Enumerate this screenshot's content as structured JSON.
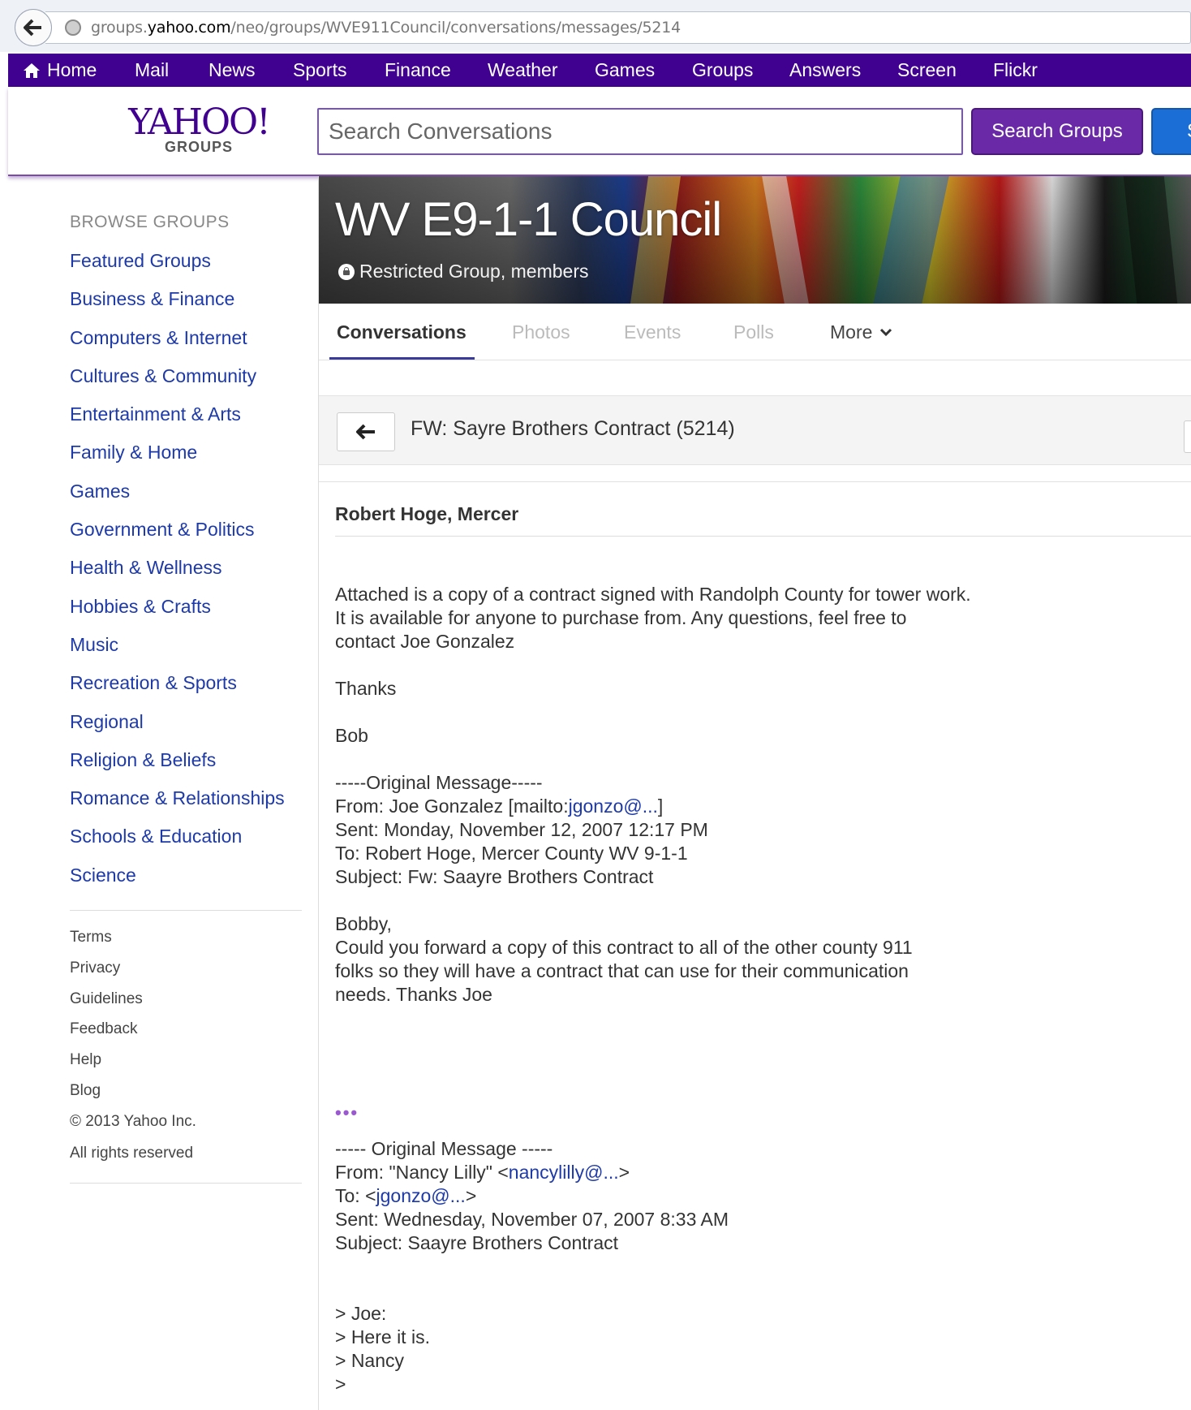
{
  "browser": {
    "url_prefix": "groups.",
    "url_domain": "yahoo.com",
    "url_path": "/neo/groups/WVE911Council/conversations/messages/5214"
  },
  "nav": {
    "items": [
      "Home",
      "Mail",
      "News",
      "Sports",
      "Finance",
      "Weather",
      "Games",
      "Groups",
      "Answers",
      "Screen",
      "Flickr"
    ]
  },
  "header": {
    "logo_main": "YAHOO!",
    "logo_sub": "GROUPS",
    "search_placeholder": "Search Conversations",
    "search_groups_label": "Search Groups",
    "web_button_label": "S"
  },
  "sidebar": {
    "title": "BROWSE GROUPS",
    "categories": [
      "Featured Groups",
      "Business & Finance",
      "Computers & Internet",
      "Cultures & Community",
      "Entertainment & Arts",
      "Family & Home",
      "Games",
      "Government & Politics",
      "Health & Wellness",
      "Hobbies & Crafts",
      "Music",
      "Recreation & Sports",
      "Regional",
      "Religion & Beliefs",
      "Romance & Relationships",
      "Schools & Education",
      "Science"
    ],
    "footer_links": [
      "Terms",
      "Privacy",
      "Guidelines",
      "Feedback",
      "Help",
      "Blog"
    ],
    "copyright": "© 2013 Yahoo Inc.",
    "rights": "All rights reserved"
  },
  "group": {
    "title": "WV E9-1-1 Council",
    "subtitle": "Restricted Group, members"
  },
  "tabs": {
    "conversations": "Conversations",
    "photos": "Photos",
    "events": "Events",
    "polls": "Polls",
    "more": "More"
  },
  "thread": {
    "title": "FW: Sayre Brothers Contract (5214)"
  },
  "message": {
    "author": "Robert Hoge, Mercer",
    "p1_l1": "Attached is a copy of a contract signed with Randolph County for tower work.",
    "p1_l2": "It is available for anyone to purchase from. Any questions, feel free to",
    "p1_l3": "contact Joe Gonzalez",
    "thanks": "Thanks",
    "bob": "Bob",
    "orig1_header": "-----Original Message-----",
    "orig1_from_prefix": "From: Joe Gonzalez [mailto:",
    "orig1_from_link": "jgonzo@...",
    "orig1_from_suffix": "]",
    "orig1_sent": "Sent: Monday, November 12, 2007 12:17 PM",
    "orig1_to": "To: Robert Hoge, Mercer County WV 9-1-1",
    "orig1_subject": "Subject: Fw: Saayre Brothers Contract",
    "bobby": "Bobby,",
    "p2_l1": "Could you forward a copy of this contract to all of the other county 911",
    "p2_l2": "folks so they will have a contract that can use for their communication",
    "p2_l3": "needs. Thanks Joe",
    "dots": "•••",
    "orig2_header": "----- Original Message -----",
    "orig2_from_prefix": "From: \"Nancy Lilly\" <",
    "orig2_from_link": "nancylilly@...",
    "orig2_from_suffix": ">",
    "orig2_to_prefix": "To: <",
    "orig2_to_link": "jgonzo@...",
    "orig2_to_suffix": ">",
    "orig2_sent": "Sent: Wednesday, November 07, 2007 8:33 AM",
    "orig2_subject": "Subject: Saayre Brothers Contract",
    "q1": "> Joe:",
    "q2": "> Here it is.",
    "q3": "> Nancy",
    "q4": ">"
  }
}
